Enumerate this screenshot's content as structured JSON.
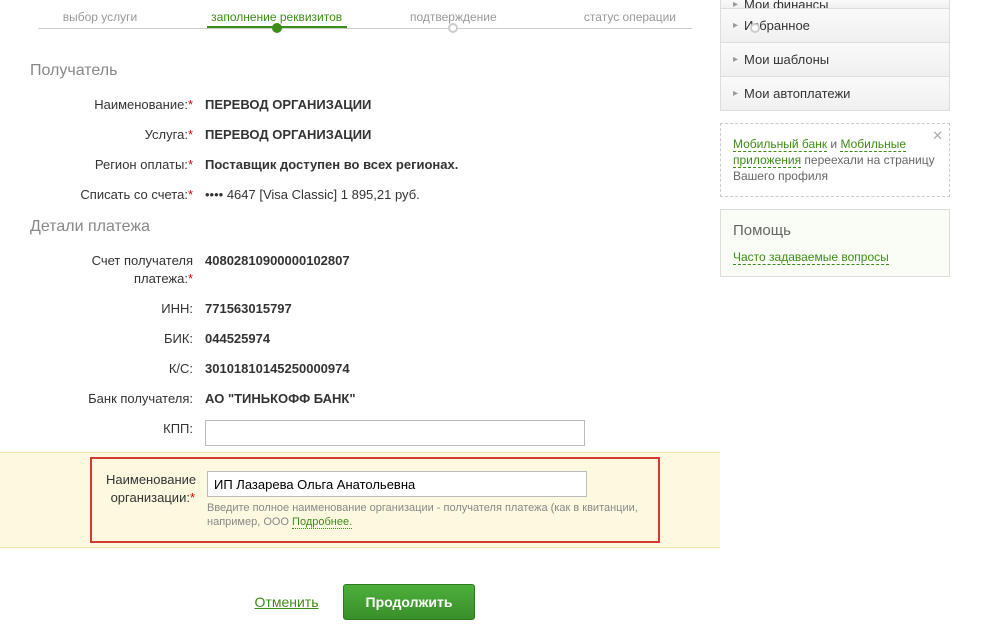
{
  "stepper": {
    "steps": [
      {
        "label": "выбор услуги"
      },
      {
        "label": "заполнение реквизитов"
      },
      {
        "label": "подтверждение"
      },
      {
        "label": "статус операции"
      }
    ]
  },
  "sections": {
    "recipient_title": "Получатель",
    "payment_details_title": "Детали платежа"
  },
  "fields": {
    "name_label": "Наименование:",
    "name_value": "ПЕРЕВОД ОРГАНИЗАЦИИ",
    "service_label": "Услуга:",
    "service_value": "ПЕРЕВОД ОРГАНИЗАЦИИ",
    "region_label": "Регион оплаты:",
    "region_value": "Поставщик доступен во всех регионах.",
    "account_label": "Списать со счета:",
    "account_value": "•••• 4647  [Visa Classic] 1 895,21   руб.",
    "recipient_acct_label": "Счет получателя платежа:",
    "recipient_acct_value": "40802810900000102807",
    "inn_label": "ИНН:",
    "inn_value": "771563015797",
    "bik_label": "БИК:",
    "bik_value": "044525974",
    "ks_label": "К/С:",
    "ks_value": "30101810145250000974",
    "bank_label": "Банк получателя:",
    "bank_value": "АО \"ТИНЬКОФФ БАНК\"",
    "kpp_label": "КПП:",
    "kpp_value": "",
    "org_name_label": "Наименование организации:",
    "org_name_value": "ИП Лазарева Ольга Анатольевна",
    "org_hint_prefix": "Введите полное наименование организации - получателя платежа (как в квитанции, например, ООО ",
    "org_hint_link": "Подробнее."
  },
  "actions": {
    "cancel": "Отменить",
    "continue": "Продолжить"
  },
  "sidebar": {
    "menu": [
      "Мои финансы",
      "Избранное",
      "Мои шаблоны",
      "Мои автоплатежи"
    ],
    "notice": {
      "link1": "Мобильный банк",
      "mid1": " и ",
      "link2": "Мобильные приложения",
      "tail": " переехали на страницу Вашего профиля"
    },
    "help": {
      "title": "Помощь",
      "faq": "Часто задаваемые вопросы"
    }
  }
}
